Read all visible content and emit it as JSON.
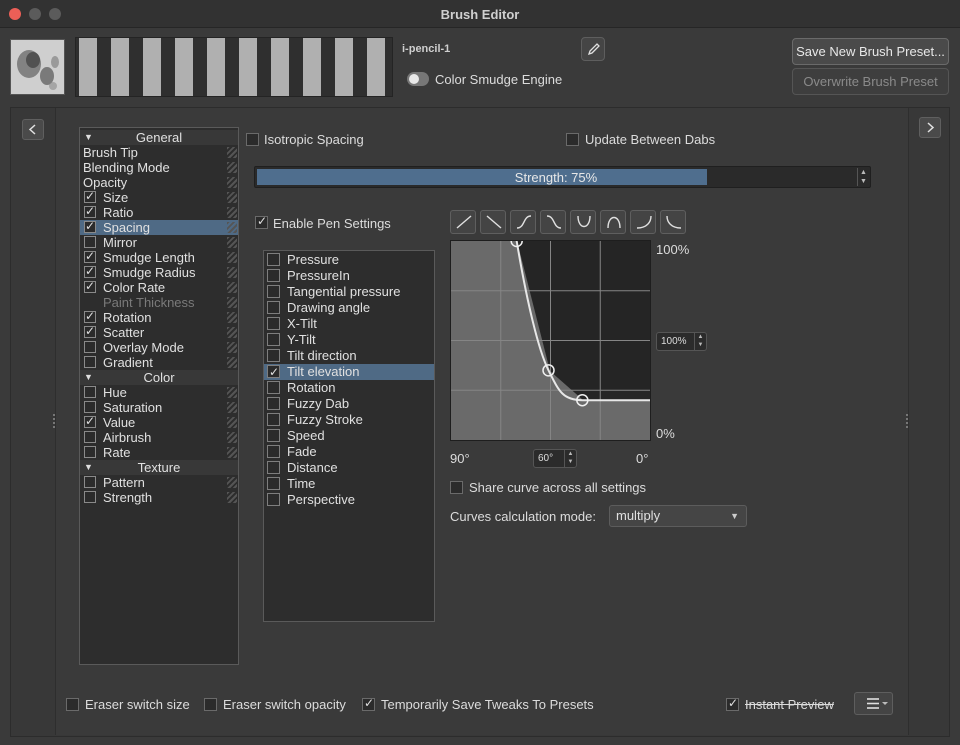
{
  "window": {
    "title": "Brush Editor"
  },
  "header": {
    "preset_name": "i-pencil-1",
    "engine_label": "Color Smudge Engine",
    "save_new_label": "Save New Brush Preset...",
    "overwrite_label": "Overwrite Brush Preset"
  },
  "options": [
    {
      "type": "header",
      "label": "General"
    },
    {
      "type": "plain",
      "label": "Brush Tip"
    },
    {
      "type": "plain",
      "label": "Blending Mode"
    },
    {
      "type": "plain",
      "label": "Opacity"
    },
    {
      "type": "check",
      "label": "Size",
      "checked": true
    },
    {
      "type": "check",
      "label": "Ratio",
      "checked": true
    },
    {
      "type": "check",
      "label": "Spacing",
      "checked": true,
      "selected": true
    },
    {
      "type": "check",
      "label": "Mirror",
      "checked": false
    },
    {
      "type": "check",
      "label": "Smudge Length",
      "checked": true
    },
    {
      "type": "check",
      "label": "Smudge Radius",
      "checked": true
    },
    {
      "type": "check",
      "label": "Color Rate",
      "checked": true
    },
    {
      "type": "disabled",
      "label": "Paint Thickness"
    },
    {
      "type": "check",
      "label": "Rotation",
      "checked": true
    },
    {
      "type": "check",
      "label": "Scatter",
      "checked": true
    },
    {
      "type": "check",
      "label": "Overlay Mode",
      "checked": false
    },
    {
      "type": "check",
      "label": "Gradient",
      "checked": false
    },
    {
      "type": "header",
      "label": "Color"
    },
    {
      "type": "check",
      "label": "Hue",
      "checked": false
    },
    {
      "type": "check",
      "label": "Saturation",
      "checked": false
    },
    {
      "type": "check",
      "label": "Value",
      "checked": true
    },
    {
      "type": "check",
      "label": "Airbrush",
      "checked": false
    },
    {
      "type": "check",
      "label": "Rate",
      "checked": false
    },
    {
      "type": "header",
      "label": "Texture"
    },
    {
      "type": "check",
      "label": "Pattern",
      "checked": false
    },
    {
      "type": "check",
      "label": "Strength",
      "checked": false
    }
  ],
  "spacing": {
    "isotropic_label": "Isotropic Spacing",
    "update_between_label": "Update Between Dabs",
    "strength_label": "Strength: 75%",
    "strength_value": 0.75,
    "enable_pen_label": "Enable Pen Settings"
  },
  "sensors": [
    {
      "label": "Pressure",
      "checked": false
    },
    {
      "label": "PressureIn",
      "checked": false
    },
    {
      "label": "Tangential pressure",
      "checked": false
    },
    {
      "label": "Drawing angle",
      "checked": false
    },
    {
      "label": "X-Tilt",
      "checked": false
    },
    {
      "label": "Y-Tilt",
      "checked": false
    },
    {
      "label": "Tilt direction",
      "checked": false
    },
    {
      "label": "Tilt elevation",
      "checked": true,
      "selected": true
    },
    {
      "label": "Rotation",
      "checked": false
    },
    {
      "label": "Fuzzy Dab",
      "checked": false
    },
    {
      "label": "Fuzzy Stroke",
      "checked": false
    },
    {
      "label": "Speed",
      "checked": false
    },
    {
      "label": "Fade",
      "checked": false
    },
    {
      "label": "Distance",
      "checked": false
    },
    {
      "label": "Time",
      "checked": false
    },
    {
      "label": "Perspective",
      "checked": false
    }
  ],
  "curve": {
    "y_max_label": "100%",
    "y_min_label": "0%",
    "y_spin_value": "100%",
    "x_left_label": "90°",
    "x_right_label": "0°",
    "x_spin_value": "60°",
    "points": [
      [
        0.33,
        1.0
      ],
      [
        0.49,
        0.35
      ],
      [
        0.66,
        0.2
      ]
    ]
  },
  "share_curve_label": "Share curve across all settings",
  "calc_mode": {
    "label": "Curves calculation mode:",
    "value": "multiply"
  },
  "footer": {
    "eraser_size_label": "Eraser switch size",
    "eraser_opacity_label": "Eraser switch opacity",
    "temp_save_label": "Temporarily Save Tweaks To Presets",
    "instant_preview_label": "Instant Preview"
  },
  "colors": {
    "selection": "#4f6a85",
    "accent": "#4f6e8e",
    "close": "#ec5f57",
    "minimize": "#5a5a5a",
    "zoom": "#5a5a5a"
  }
}
